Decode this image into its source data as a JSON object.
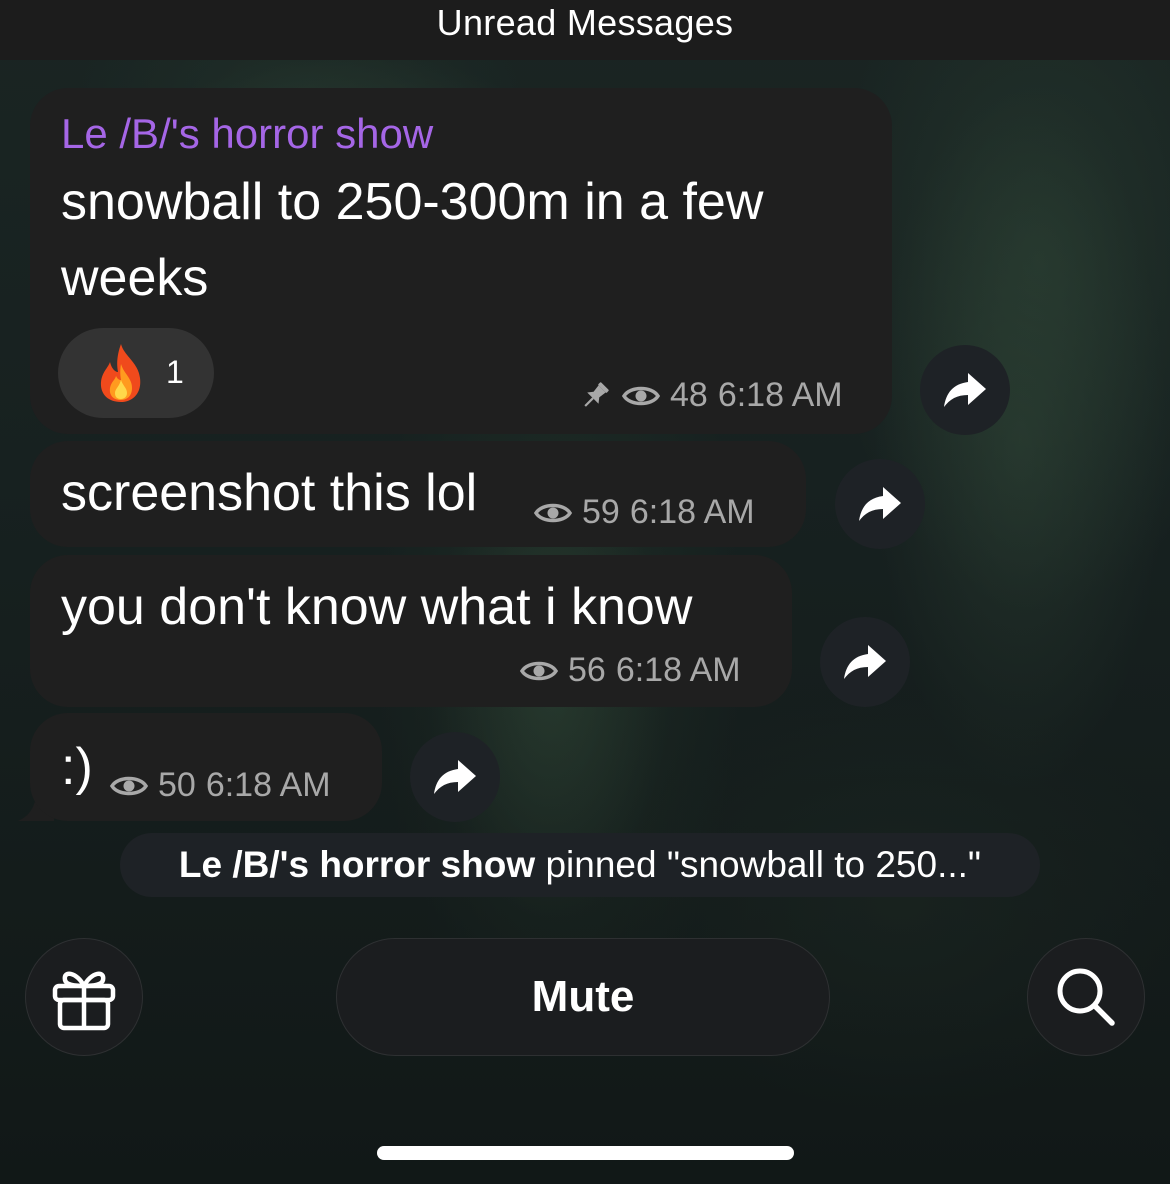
{
  "header": {
    "title": "Unread Messages"
  },
  "messages": [
    {
      "sender": "Le /B/'s horror show",
      "lines": [
        "snowball to 250-300m in a few",
        "weeks"
      ],
      "reaction": {
        "emoji": "fire",
        "count": "1"
      },
      "pinned": true,
      "views": "48",
      "time": "6:18 AM"
    },
    {
      "text": "screenshot this lol",
      "views": "59",
      "time": "6:18 AM"
    },
    {
      "text": "you don't know what i know",
      "views": "56",
      "time": "6:18 AM"
    },
    {
      "text": ":)",
      "views": "50",
      "time": "6:18 AM"
    }
  ],
  "service_message": {
    "actor": "Le /B/'s horror show",
    "action": "pinned \"snowball to 250...\""
  },
  "bottom_bar": {
    "mute_label": "Mute"
  },
  "icons": {
    "forward": "forward-arrow-icon",
    "views": "eye-icon",
    "pin": "pin-icon",
    "gift": "gift-icon",
    "search": "search-icon"
  },
  "colors": {
    "sender_name": "#a566e6",
    "bubble": "#1f1f1f",
    "meta_text": "#a8a8a8"
  }
}
